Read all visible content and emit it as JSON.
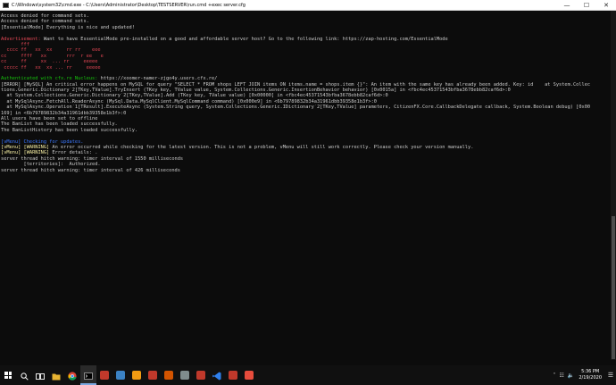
{
  "window": {
    "title": "C:\\Windows\\system32\\cmd.exe - C:\\Users\\Administrator\\Desktop\\TESTSERVER\\run.cmd  +exec server.cfg",
    "minimize_glyph": "—",
    "maximize_glyph": "☐",
    "close_glyph": "✕"
  },
  "console": {
    "lines": [
      {
        "segments": [
          {
            "text": "Access denied for command sets.",
            "color": "white"
          }
        ]
      },
      {
        "segments": [
          {
            "text": "Access denied for command sets.",
            "color": "white"
          }
        ]
      },
      {
        "segments": [
          {
            "text": "[EssentialMode] Everything is nice and updated!",
            "color": "white"
          }
        ]
      },
      {
        "segments": [
          {
            "text": "",
            "color": "white"
          }
        ]
      },
      {
        "segments": [
          {
            "text": "Advertisement: ",
            "color": "red"
          },
          {
            "text": "Want to have EssentialMode pre-installed on a good and affordable server host? Go to the following link: https://zap-hosting.com/EssentialMode",
            "color": "white"
          }
        ]
      },
      {
        "segments": [
          {
            "text": "       fff",
            "color": "red"
          }
        ]
      },
      {
        "segments": [
          {
            "text": "  cccc ff   xx  xx     rr rr    eee",
            "color": "red"
          }
        ]
      },
      {
        "segments": [
          {
            "text": "cc     ffff   xx       rrr  r ee   e",
            "color": "red"
          }
        ]
      },
      {
        "segments": [
          {
            "text": "cc     ff     xx  ... rr     eeeee",
            "color": "red"
          }
        ]
      },
      {
        "segments": [
          {
            "text": " ccccc ff   xx  xx ... rr     eeeee",
            "color": "red"
          }
        ]
      },
      {
        "segments": [
          {
            "text": "",
            "color": "white"
          }
        ]
      },
      {
        "segments": [
          {
            "text": "Authenticated with cfx.re Nucleus: ",
            "color": "green"
          },
          {
            "text": "https://xoomer-namer-zjgo4y.users.cfx.re/",
            "color": "white"
          }
        ]
      },
      {
        "segments": [
          {
            "text": "[ERROR] [MySQL] An critical error happens on MySQL for query \"SELECT * FROM shops LEFT JOIN items ON items.name = shops.item {}\": An item with the same key has already been added. Key: id    at System.Collec",
            "color": "white"
          }
        ]
      },
      {
        "segments": [
          {
            "text": "tions.Generic.Dictionary`2[TKey,TValue].TryInsert (TKey key, TValue value, System.Collections.Generic.InsertionBehavior behavior) [0x0015a] in <fbc4ec45371543bfba3678ebb82caf6d>:0",
            "color": "white"
          }
        ]
      },
      {
        "segments": [
          {
            "text": "  at System.Collections.Generic.Dictionary`2[TKey,TValue].Add (TKey key, TValue value) [0x00000] in <fbc4ec45371543bfba3678ebb82caf6d>:0",
            "color": "white"
          }
        ]
      },
      {
        "segments": [
          {
            "text": "  at MySqlAsync.FetchAll.ReaderAsync (MySql.Data.MySqlClient.MySqlCommand command) [0x000e9] in <6b79789832b34a31961dbb39358e1b3f>:0",
            "color": "white"
          }
        ]
      },
      {
        "segments": [
          {
            "text": "  at MySqlAsync.Operation`1[TResult].ExecuteAsync (System.String query, System.Collections.Generic.IDictionary`2[TKey,TValue] parameters, CitizenFX.Core.CallbackDelegate callback, System.Boolean debug) [0x00",
            "color": "white"
          }
        ]
      },
      {
        "segments": [
          {
            "text": "169] in <6b79789832b34a31961dbb39358e1b3f>:0",
            "color": "white"
          }
        ]
      },
      {
        "segments": [
          {
            "text": "All users have been set to offline",
            "color": "white"
          }
        ]
      },
      {
        "segments": [
          {
            "text": "The BanList has been loaded successfully.",
            "color": "white"
          }
        ]
      },
      {
        "segments": [
          {
            "text": "The BanListHistory has been loaded successfully.",
            "color": "white"
          }
        ]
      },
      {
        "segments": [
          {
            "text": "",
            "color": "white"
          }
        ]
      },
      {
        "segments": [
          {
            "text": "[vMenu] Checking for updates.",
            "color": "blue"
          }
        ]
      },
      {
        "segments": [
          {
            "text": "[vMenu] [WARNING]",
            "color": "yellow"
          },
          {
            "text": " An error occurred while checking for the latest version. This is not a problem, vMenu will still work correctly. Please check your version manually.",
            "color": "white"
          }
        ]
      },
      {
        "segments": [
          {
            "text": "[vMenu] [WARNING]",
            "color": "yellow"
          },
          {
            "text": " Error details: .",
            "color": "white"
          }
        ]
      },
      {
        "segments": [
          {
            "text": "server thread hitch warning: timer interval of 1550 milliseconds",
            "color": "white"
          }
        ]
      },
      {
        "segments": [
          {
            "text": "        [territories]:  Authorized.",
            "color": "white"
          }
        ]
      },
      {
        "segments": [
          {
            "text": "server thread hitch warning: timer interval of 426 milliseconds",
            "color": "white"
          }
        ]
      }
    ]
  },
  "colors": {
    "white": "#cccccc",
    "red": "#e74856",
    "green": "#16c60c",
    "blue": "#3b78ff",
    "yellow": "#f9f1a5"
  },
  "taskbar": {
    "apps": [
      {
        "name": "start-button",
        "icon": "windows-logo-icon",
        "color": "#ffffff"
      },
      {
        "name": "search-button",
        "icon": "search-icon",
        "color": "#ffffff"
      },
      {
        "name": "task-view-button",
        "icon": "task-view-icon",
        "color": "#ffffff"
      },
      {
        "name": "taskbar-app-file-explorer",
        "icon": "folder-icon",
        "color": "#e8b432"
      },
      {
        "name": "taskbar-app-chrome",
        "icon": "chrome-icon",
        "color": "#34a853"
      },
      {
        "name": "taskbar-app-cmd",
        "icon": "terminal-icon",
        "color": "#3a3a3a"
      },
      {
        "name": "taskbar-app-server-red",
        "icon": "app-red-icon",
        "color": "#c0392b"
      },
      {
        "name": "taskbar-app-photos",
        "icon": "photos-icon",
        "color": "#3b82c4"
      },
      {
        "name": "taskbar-app-fivem",
        "icon": "fivem-icon",
        "color": "#f39c12"
      },
      {
        "name": "taskbar-app-red-2",
        "icon": "app-red-icon",
        "color": "#c0392b"
      },
      {
        "name": "taskbar-app-red-3",
        "icon": "app-red-icon",
        "color": "#d35400"
      },
      {
        "name": "taskbar-app-gray",
        "icon": "app-gray-icon",
        "color": "#7f8c8d"
      },
      {
        "name": "taskbar-app-red-4",
        "icon": "app-red-icon",
        "color": "#c0392b"
      },
      {
        "name": "taskbar-app-vscode",
        "icon": "vscode-icon",
        "color": "#2f80ed"
      },
      {
        "name": "taskbar-app-red-5",
        "icon": "app-red-icon",
        "color": "#c0392b"
      },
      {
        "name": "taskbar-app-red-6",
        "icon": "app-red-icon",
        "color": "#e74c3c"
      }
    ],
    "active_index": 5,
    "tray": {
      "chevron": "˄",
      "network": "☷",
      "volume": "🔈",
      "time": "5:36 PM",
      "date": "2/19/2020",
      "notification": "☰"
    }
  }
}
